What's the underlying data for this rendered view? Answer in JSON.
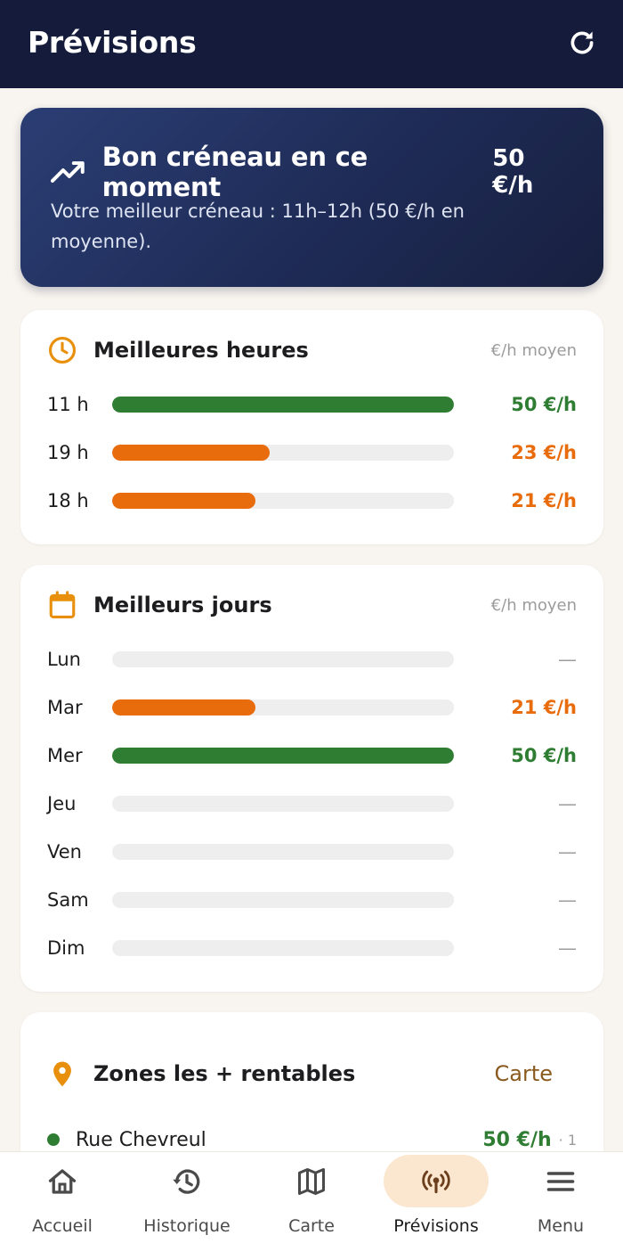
{
  "header": {
    "title": "Prévisions",
    "refresh_icon": "refresh-icon"
  },
  "hero": {
    "icon": "trending-up-icon",
    "title": "Bon créneau en ce moment",
    "rate": "50 €/h",
    "description": "Votre meilleur créneau : 11h–12h (50 €/h en moyenne)."
  },
  "best_hours": {
    "icon": "clock-icon",
    "title": "Meilleures heures",
    "note": "€/h moyen",
    "rows": [
      {
        "label": "11 h",
        "value": "50 €/h",
        "level": 1.0,
        "color": "#2e7d32"
      },
      {
        "label": "19 h",
        "value": "23 €/h",
        "level": 0.46,
        "color": "#e86c0c"
      },
      {
        "label": "18 h",
        "value": "21 €/h",
        "level": 0.42,
        "color": "#e86c0c"
      }
    ]
  },
  "best_days": {
    "icon": "calendar-icon",
    "title": "Meilleurs jours",
    "note": "€/h moyen",
    "rows": [
      {
        "label": "Lun",
        "value": "—",
        "level": 0,
        "color": "#9c9c9c"
      },
      {
        "label": "Mar",
        "value": "21 €/h",
        "level": 0.42,
        "color": "#e86c0c"
      },
      {
        "label": "Mer",
        "value": "50 €/h",
        "level": 1.0,
        "color": "#2e7d32"
      },
      {
        "label": "Jeu",
        "value": "—",
        "level": 0,
        "color": "#9c9c9c"
      },
      {
        "label": "Ven",
        "value": "—",
        "level": 0,
        "color": "#9c9c9c"
      },
      {
        "label": "Sam",
        "value": "—",
        "level": 0,
        "color": "#9c9c9c"
      },
      {
        "label": "Dim",
        "value": "—",
        "level": 0,
        "color": "#9c9c9c"
      }
    ]
  },
  "zones": {
    "icon": "map-pin-icon",
    "title": "Zones les + rentables",
    "link": "Carte",
    "items": [
      {
        "name": "Rue Chevreul",
        "value": "50 €/h",
        "count": "· 1",
        "color": "#2e7d32"
      }
    ]
  },
  "nav": {
    "items": [
      {
        "label": "Accueil",
        "icon": "home-icon",
        "active": false
      },
      {
        "label": "Historique",
        "icon": "history-icon",
        "active": false
      },
      {
        "label": "Carte",
        "icon": "map-icon",
        "active": false
      },
      {
        "label": "Prévisions",
        "icon": "broadcast-icon",
        "active": true
      },
      {
        "label": "Menu",
        "icon": "menu-icon",
        "active": false
      }
    ]
  },
  "colors": {
    "header_bg": "#151c3b",
    "accent_orange": "#e86c0c",
    "accent_green": "#2e7d32",
    "icon_orange": "#e8900c",
    "active_pill": "#fbe7cf"
  }
}
